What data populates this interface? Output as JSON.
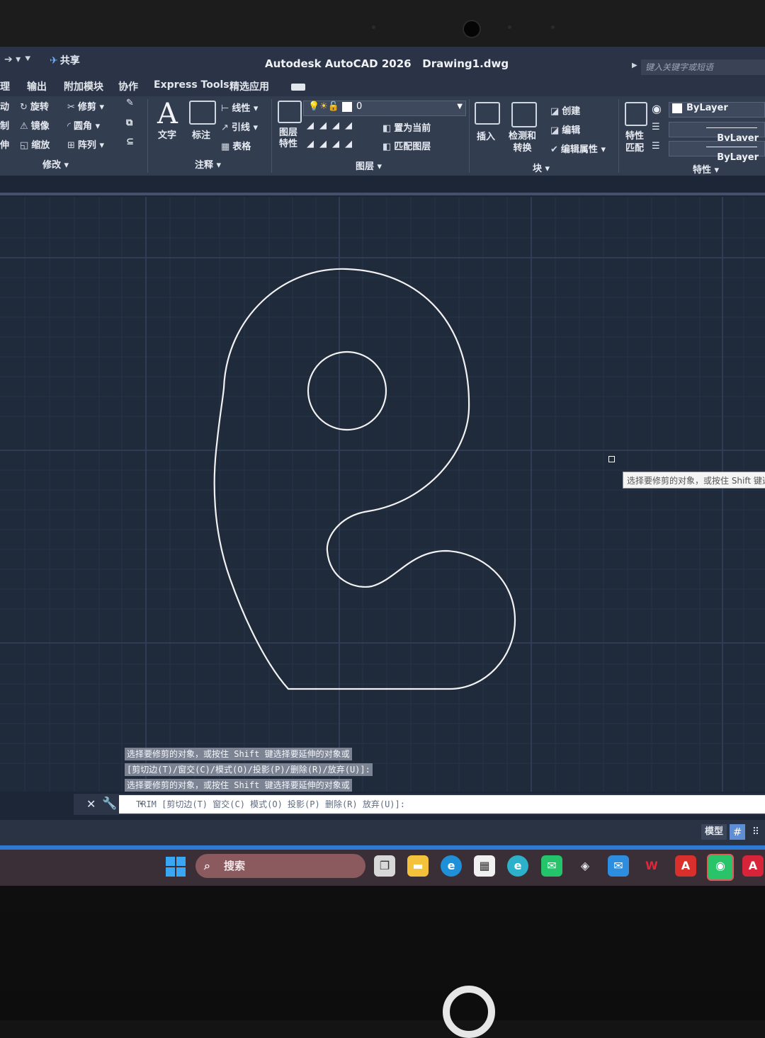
{
  "window": {
    "app_title": "Autodesk AutoCAD 2026",
    "file_name": "Drawing1.dwg",
    "share_label": "共享",
    "search_placeholder": "键入关键字或短语"
  },
  "tabs": [
    "理",
    "输出",
    "附加模块",
    "协作",
    "Express Tools",
    "精选应用"
  ],
  "ribbon": {
    "modify": {
      "title": "修改",
      "items": [
        "动",
        "旋转",
        "修剪",
        "制",
        "镜像",
        "圆角",
        "伸",
        "缩放",
        "阵列"
      ]
    },
    "annotation": {
      "title": "注释",
      "text_label": "文字",
      "dim_label": "标注",
      "linear_label": "线性",
      "leader_label": "引线",
      "table_label": "表格"
    },
    "layers": {
      "title": "图层",
      "layer_props_label": "图层\n特性",
      "current_layer": "0",
      "make_current_label": "置为当前",
      "match_layer_label": "匹配图层"
    },
    "block": {
      "title": "块",
      "insert_label": "插入",
      "detect_label": "检测和\n转换",
      "create_label": "创建",
      "edit_label": "编辑",
      "edit_attr_label": "编辑属性"
    },
    "properties": {
      "title": "特性",
      "match_label": "特性\n匹配",
      "color": "ByLayer",
      "linetype": "ByLayer",
      "lineweight": "ByLayer"
    }
  },
  "canvas": {
    "tooltip": "选择要修剪的对象，或按住 Shift 键选择要延伸的对象或",
    "history": [
      "选择要修剪的对象，或按住 Shift 键选择要延伸的对象或",
      "[剪切边(T)/窗交(C)/模式(O)/投影(P)/删除(R)/放弃(U)]:",
      "选择要修剪的对象，或按住 Shift 键选择要延伸的对象或"
    ],
    "command_line": "TRIM [剪切边(T) 窗交(C) 模式(O) 投影(P) 删除(R) 放弃(U)]:"
  },
  "statusbar": {
    "model_label": "模型"
  },
  "taskbar": {
    "search_label": "搜索",
    "apps": [
      "task-view",
      "file-explorer",
      "edge",
      "store",
      "edge-dev",
      "wechat-work",
      "unity",
      "mail",
      "wps",
      "acrobat",
      "wechat",
      "autocad"
    ]
  },
  "colors": {
    "canvas_bg": "#1f2a3b",
    "ribbon_bg": "#333d50",
    "accent": "#2e7bd6",
    "geometry": "#f2f2f2"
  }
}
